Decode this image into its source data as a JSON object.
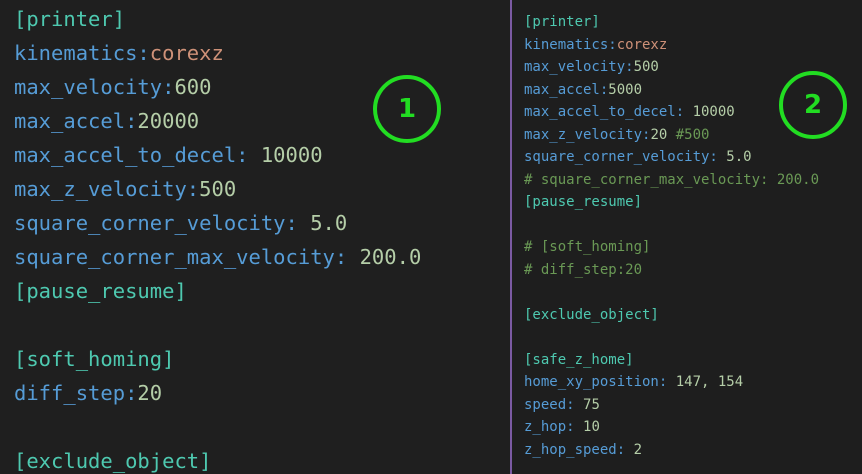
{
  "left_pane": {
    "badge": "1",
    "lines": [
      [
        {
          "text": "[printer]",
          "style": "sec"
        }
      ],
      [
        {
          "text": "kinematics:",
          "style": "key"
        },
        {
          "text": "corexz",
          "style": "str"
        }
      ],
      [
        {
          "text": "max_velocity:",
          "style": "key"
        },
        {
          "text": "600",
          "style": "num"
        }
      ],
      [
        {
          "text": "max_accel:",
          "style": "key"
        },
        {
          "text": "20000",
          "style": "num"
        }
      ],
      [
        {
          "text": "max_accel_to_decel: ",
          "style": "key"
        },
        {
          "text": "10000",
          "style": "num"
        }
      ],
      [
        {
          "text": "max_z_velocity:",
          "style": "key"
        },
        {
          "text": "500",
          "style": "num"
        }
      ],
      [
        {
          "text": "square_corner_velocity: ",
          "style": "key"
        },
        {
          "text": "5.0",
          "style": "num"
        }
      ],
      [
        {
          "text": "square_corner_max_velocity: ",
          "style": "key"
        },
        {
          "text": "200.0",
          "style": "num"
        }
      ],
      [
        {
          "text": "[pause_resume]",
          "style": "sec"
        }
      ],
      [],
      [
        {
          "text": "[soft_homing]",
          "style": "sec"
        }
      ],
      [
        {
          "text": "diff_step:",
          "style": "key"
        },
        {
          "text": "20",
          "style": "num"
        }
      ],
      [],
      [
        {
          "text": "[exclude_object]",
          "style": "sec"
        }
      ]
    ]
  },
  "right_pane": {
    "badge": "2",
    "lines": [
      [
        {
          "text": "[printer]",
          "style": "sec"
        }
      ],
      [
        {
          "text": "kinematics:",
          "style": "key"
        },
        {
          "text": "corexz",
          "style": "str"
        }
      ],
      [
        {
          "text": "max_velocity:",
          "style": "key"
        },
        {
          "text": "500",
          "style": "num"
        }
      ],
      [
        {
          "text": "max_accel:",
          "style": "key"
        },
        {
          "text": "5000",
          "style": "num"
        }
      ],
      [
        {
          "text": "max_accel_to_decel: ",
          "style": "key"
        },
        {
          "text": "10000",
          "style": "num"
        }
      ],
      [
        {
          "text": "max_z_velocity:",
          "style": "key"
        },
        {
          "text": "20 ",
          "style": "num"
        },
        {
          "text": "#500",
          "style": "cmt"
        }
      ],
      [
        {
          "text": "square_corner_velocity: ",
          "style": "key"
        },
        {
          "text": "5.0",
          "style": "num"
        }
      ],
      [
        {
          "text": "# square_corner_max_velocity: 200.0",
          "style": "cmt"
        }
      ],
      [
        {
          "text": "[pause_resume]",
          "style": "sec"
        }
      ],
      [],
      [
        {
          "text": "# [soft_homing]",
          "style": "cmt"
        }
      ],
      [
        {
          "text": "# diff_step:20",
          "style": "cmt"
        }
      ],
      [],
      [
        {
          "text": "[exclude_object]",
          "style": "sec"
        }
      ],
      [],
      [
        {
          "text": "[safe_z_home]",
          "style": "sec"
        }
      ],
      [
        {
          "text": "home_xy_position: ",
          "style": "key"
        },
        {
          "text": "147, 154",
          "style": "num"
        }
      ],
      [
        {
          "text": "speed: ",
          "style": "key"
        },
        {
          "text": "75",
          "style": "num"
        }
      ],
      [
        {
          "text": "z_hop: ",
          "style": "key"
        },
        {
          "text": "10",
          "style": "num"
        }
      ],
      [
        {
          "text": "z_hop_speed: ",
          "style": "key"
        },
        {
          "text": "2",
          "style": "num"
        }
      ]
    ]
  },
  "colors": {
    "section": "#4ec9b0",
    "key": "#569cd6",
    "number": "#b5cea8",
    "string": "#ce9178",
    "comment": "#6a9955",
    "badge": "#22dd22",
    "divider": "#9b6fd0"
  }
}
